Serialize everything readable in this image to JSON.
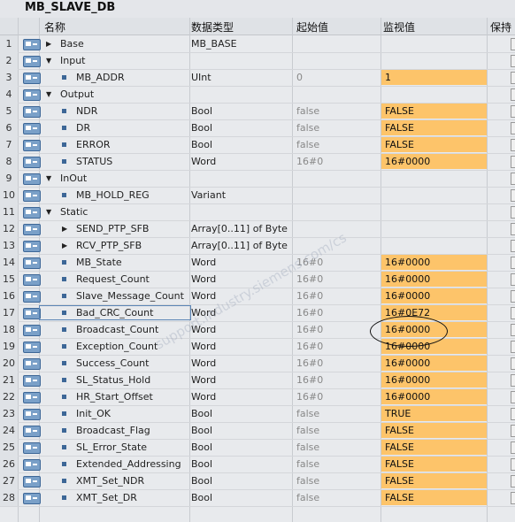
{
  "window": {
    "title": "MB_SLAVE_DB"
  },
  "columns": {
    "name": "名称",
    "type": "数据类型",
    "start": "起始值",
    "monitor": "监视值",
    "keep": "保持"
  },
  "watermark": "support.industry.siemens.com/cs",
  "rows": [
    {
      "num": "1",
      "name": "Base",
      "type": "MB_BASE",
      "start": "",
      "monitor": "",
      "level": 0,
      "tri": "right",
      "icon": true
    },
    {
      "num": "2",
      "name": "Input",
      "type": "",
      "start": "",
      "monitor": "",
      "level": 0,
      "tri": "down",
      "icon": true
    },
    {
      "num": "3",
      "name": "MB_ADDR",
      "type": "UInt",
      "start": "0",
      "monitor": "1",
      "level": 1,
      "icon": true
    },
    {
      "num": "4",
      "name": "Output",
      "type": "",
      "start": "",
      "monitor": "",
      "level": 0,
      "tri": "down",
      "icon": true
    },
    {
      "num": "5",
      "name": "NDR",
      "type": "Bool",
      "start": "false",
      "monitor": "FALSE",
      "level": 1,
      "icon": true
    },
    {
      "num": "6",
      "name": "DR",
      "type": "Bool",
      "start": "false",
      "monitor": "FALSE",
      "level": 1,
      "icon": true
    },
    {
      "num": "7",
      "name": "ERROR",
      "type": "Bool",
      "start": "false",
      "monitor": "FALSE",
      "level": 1,
      "icon": true
    },
    {
      "num": "8",
      "name": "STATUS",
      "type": "Word",
      "start": "16#0",
      "monitor": "16#0000",
      "level": 1,
      "icon": true
    },
    {
      "num": "9",
      "name": "InOut",
      "type": "",
      "start": "",
      "monitor": "",
      "level": 0,
      "tri": "down",
      "icon": true
    },
    {
      "num": "10",
      "name": "MB_HOLD_REG",
      "type": "Variant",
      "start": "",
      "monitor": "",
      "level": 1,
      "icon": true
    },
    {
      "num": "11",
      "name": "Static",
      "type": "",
      "start": "",
      "monitor": "",
      "level": 0,
      "tri": "down",
      "icon": true
    },
    {
      "num": "12",
      "name": "SEND_PTP_SFB",
      "type": "Array[0..11] of Byte",
      "start": "",
      "monitor": "",
      "level": 1,
      "tri": "right",
      "icon": true
    },
    {
      "num": "13",
      "name": "RCV_PTP_SFB",
      "type": "Array[0..11] of Byte",
      "start": "",
      "monitor": "",
      "level": 1,
      "tri": "right",
      "icon": true
    },
    {
      "num": "14",
      "name": "MB_State",
      "type": "Word",
      "start": "16#0",
      "monitor": "16#0000",
      "level": 1,
      "icon": true
    },
    {
      "num": "15",
      "name": "Request_Count",
      "type": "Word",
      "start": "16#0",
      "monitor": "16#0000",
      "level": 1,
      "icon": true
    },
    {
      "num": "16",
      "name": "Slave_Message_Count",
      "type": "Word",
      "start": "16#0",
      "monitor": "16#0000",
      "level": 1,
      "icon": true
    },
    {
      "num": "17",
      "name": "Bad_CRC_Count",
      "type": "Word",
      "start": "16#0",
      "monitor": "16#0E72",
      "level": 1,
      "icon": true,
      "selected": true
    },
    {
      "num": "18",
      "name": "Broadcast_Count",
      "type": "Word",
      "start": "16#0",
      "monitor": "16#0000",
      "level": 1,
      "icon": true
    },
    {
      "num": "19",
      "name": "Exception_Count",
      "type": "Word",
      "start": "16#0",
      "monitor": "16#0000",
      "level": 1,
      "icon": true
    },
    {
      "num": "20",
      "name": "Success_Count",
      "type": "Word",
      "start": "16#0",
      "monitor": "16#0000",
      "level": 1,
      "icon": true
    },
    {
      "num": "21",
      "name": "SL_Status_Hold",
      "type": "Word",
      "start": "16#0",
      "monitor": "16#0000",
      "level": 1,
      "icon": true
    },
    {
      "num": "22",
      "name": "HR_Start_Offset",
      "type": "Word",
      "start": "16#0",
      "monitor": "16#0000",
      "level": 1,
      "icon": true
    },
    {
      "num": "23",
      "name": "Init_OK",
      "type": "Bool",
      "start": "false",
      "monitor": "TRUE",
      "level": 1,
      "icon": true
    },
    {
      "num": "24",
      "name": "Broadcast_Flag",
      "type": "Bool",
      "start": "false",
      "monitor": "FALSE",
      "level": 1,
      "icon": true
    },
    {
      "num": "25",
      "name": "SL_Error_State",
      "type": "Bool",
      "start": "false",
      "monitor": "FALSE",
      "level": 1,
      "icon": true
    },
    {
      "num": "26",
      "name": "Extended_Addressing",
      "type": "Bool",
      "start": "false",
      "monitor": "FALSE",
      "level": 1,
      "icon": true
    },
    {
      "num": "27",
      "name": "XMT_Set_NDR",
      "type": "Bool",
      "start": "false",
      "monitor": "FALSE",
      "level": 1,
      "icon": true
    },
    {
      "num": "28",
      "name": "XMT_Set_DR",
      "type": "Bool",
      "start": "false",
      "monitor": "FALSE",
      "level": 1,
      "icon": true
    }
  ]
}
